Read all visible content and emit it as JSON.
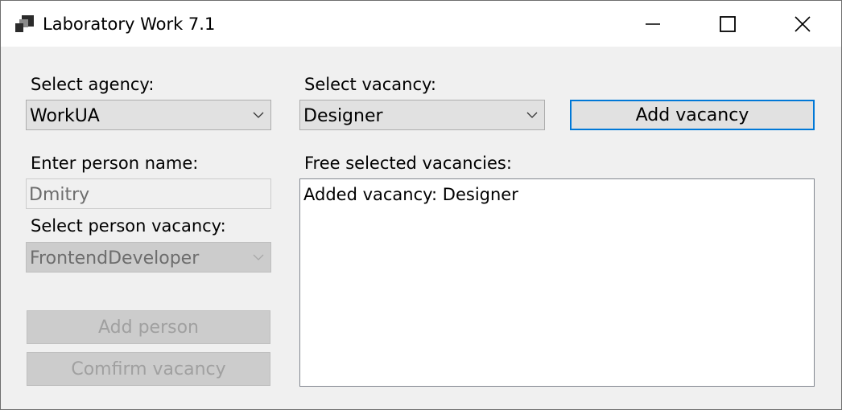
{
  "window": {
    "title": "Laboratory Work 7.1",
    "controls": {
      "minimize": "minimize",
      "maximize": "maximize",
      "close": "close"
    }
  },
  "agency": {
    "label": "Select agency:",
    "selected": "WorkUA"
  },
  "vacancy": {
    "label": "Select vacancy:",
    "selected": "Designer",
    "add_button": "Add vacancy"
  },
  "person": {
    "name_label": "Enter person name:",
    "name_value": "Dmitry",
    "vacancy_label": "Select person vacancy:",
    "vacancy_selected": "FrontendDeveloper",
    "add_button": "Add person",
    "confirm_button": "Comfirm vacancy"
  },
  "free_vacancies": {
    "label": "Free selected vacancies:",
    "items": [
      "Added vacancy: Designer"
    ]
  },
  "icons": {
    "app": "app-icon",
    "dropdown": "chevron-down-icon"
  },
  "colors": {
    "accent_border": "#0078d7",
    "window_bg": "#f0f0f0",
    "disabled_text": "#a0a0a0"
  }
}
